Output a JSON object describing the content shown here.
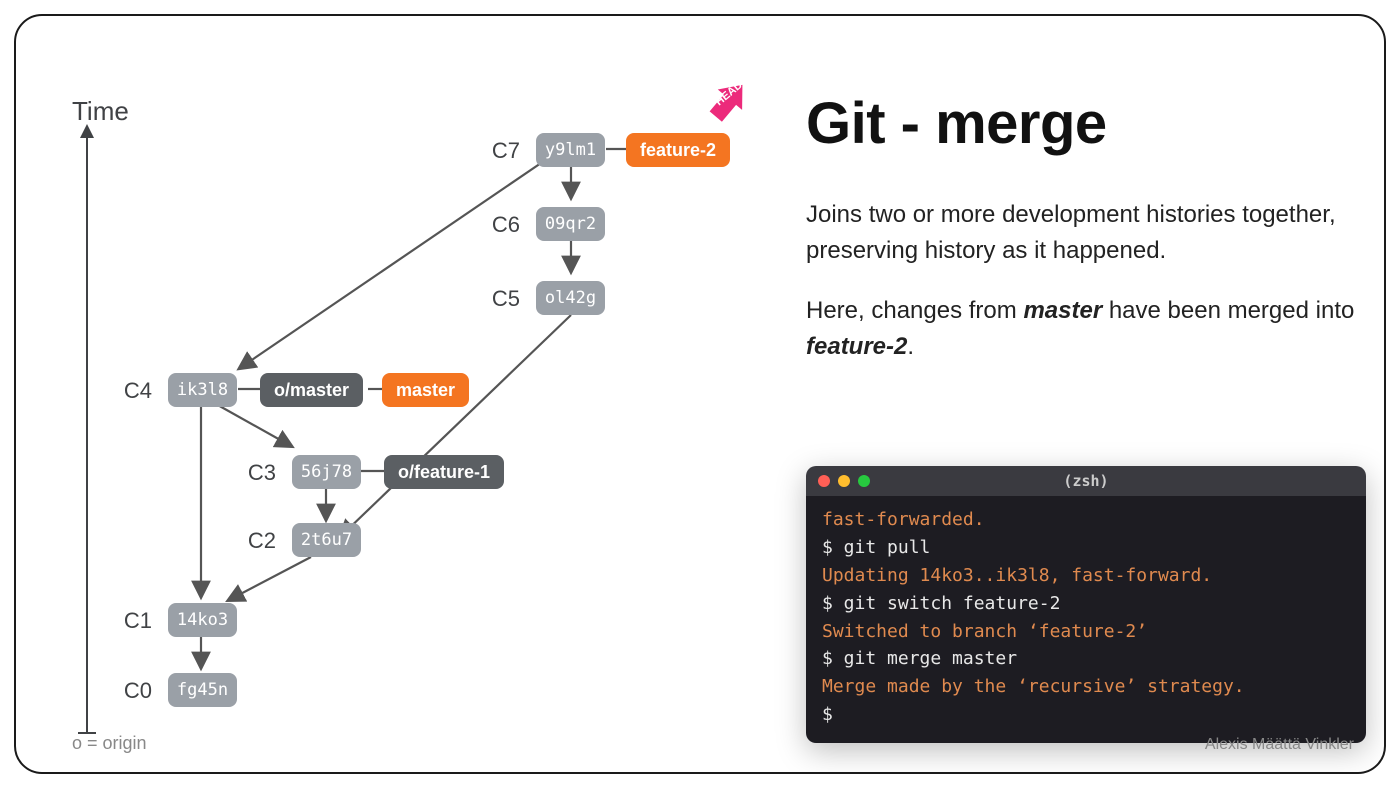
{
  "axis": {
    "label": "Time",
    "legend": "o = origin"
  },
  "commits": {
    "c7": {
      "label": "C7",
      "hash": "y9lm1"
    },
    "c6": {
      "label": "C6",
      "hash": "09qr2"
    },
    "c5": {
      "label": "C5",
      "hash": "ol42g"
    },
    "c4": {
      "label": "C4",
      "hash": "ik3l8"
    },
    "c3": {
      "label": "C3",
      "hash": "56j78"
    },
    "c2": {
      "label": "C2",
      "hash": "2t6u7"
    },
    "c1": {
      "label": "C1",
      "hash": "14ko3"
    },
    "c0": {
      "label": "C0",
      "hash": "fg45n"
    }
  },
  "refs": {
    "feature2": "feature-2",
    "head": "HEAD",
    "omaster": "o/master",
    "master": "master",
    "ofeature1": "o/feature-1"
  },
  "title": "Git - merge",
  "para1": "Joins two or more development histories together, preserving history as it happened.",
  "para2a": "Here, changes from ",
  "para2b": "master",
  "para2c": " have been merged into ",
  "para2d": "feature-2",
  "para2e": ".",
  "terminal": {
    "title": "(zsh)",
    "lines": [
      {
        "type": "out",
        "text": "fast-forwarded."
      },
      {
        "type": "cmd",
        "text": "$ git pull"
      },
      {
        "type": "out",
        "text": "Updating 14ko3..ik3l8, fast-forward."
      },
      {
        "type": "cmd",
        "text": "$ git switch feature-2"
      },
      {
        "type": "out",
        "text": "Switched to branch ‘feature-2’"
      },
      {
        "type": "cmd",
        "text": "$ git merge master"
      },
      {
        "type": "out",
        "text": "Merge made by the ‘recursive’ strategy."
      },
      {
        "type": "cmd",
        "text": "$"
      }
    ]
  },
  "credit": "Alexis Määttä Vinkler"
}
